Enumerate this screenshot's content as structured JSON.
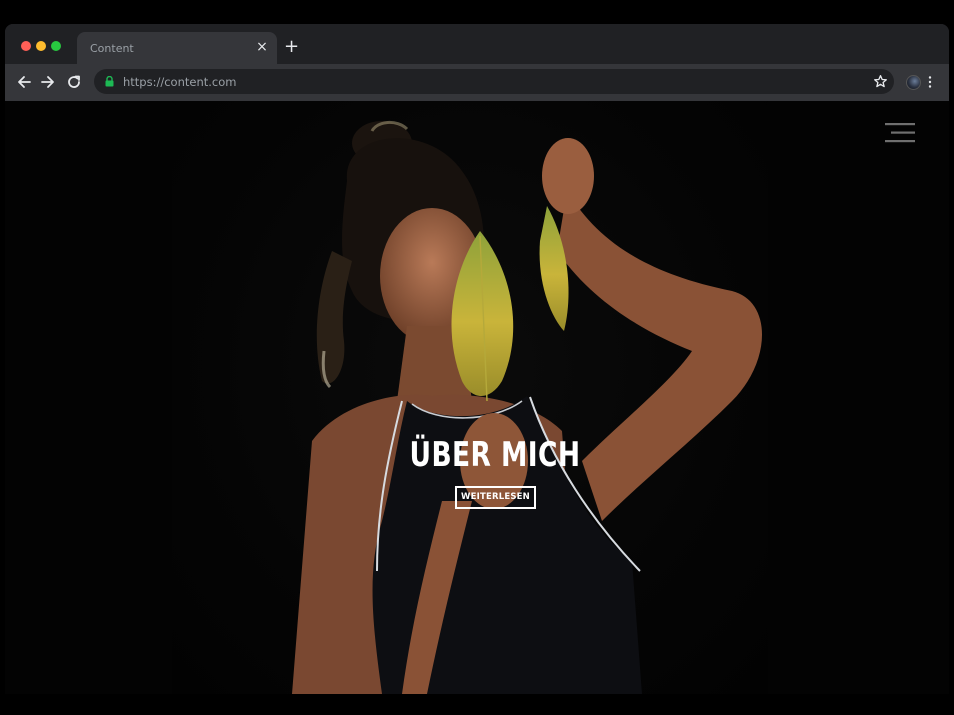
{
  "browser": {
    "tab_title": "Content",
    "tab_close_glyph": "×",
    "new_tab_glyph": "+",
    "url": "https://content.com",
    "icons": [
      "back-icon",
      "forward-icon",
      "reload-icon",
      "lock-icon",
      "star-icon",
      "profile-avatar",
      "menu-dots-icon"
    ],
    "colors": {
      "lock": "#1db954",
      "chrome": "#35363a",
      "frame": "#202124"
    }
  },
  "page": {
    "hero_title": "ÜBER MICH",
    "hero_button": "WEITERLESEN",
    "menu_icon": "hamburger-menu-icon",
    "photo_description_icon": "portrait-photo"
  }
}
